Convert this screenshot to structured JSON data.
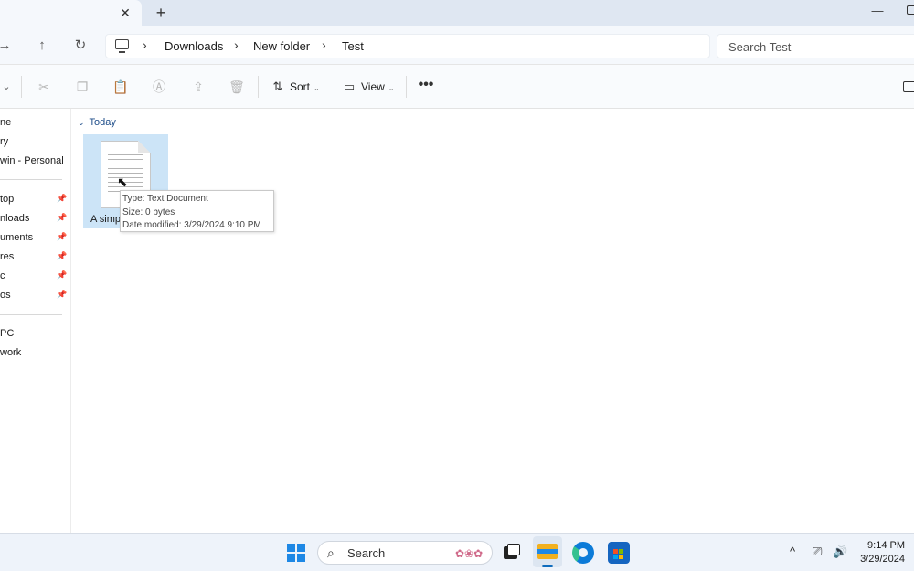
{
  "window": {
    "tab_close": "✕",
    "tab_new": "+",
    "minimize": "—"
  },
  "address": {
    "back": "→",
    "up": "↑",
    "refresh": "↻",
    "sep": "›",
    "breadcrumbs": [
      "Downloads",
      "New folder",
      "Test"
    ],
    "search_placeholder": "Search Test"
  },
  "toolbar": {
    "new_chevron": "⌄",
    "sort_label": "Sort",
    "view_label": "View",
    "more": "•••",
    "chevron": "⌄"
  },
  "sidebar": {
    "quick": [
      {
        "label": "ne"
      },
      {
        "label": "ry"
      },
      {
        "label": "win - Personal"
      }
    ],
    "pinned": [
      {
        "label": "top",
        "pin": "📌"
      },
      {
        "label": "nloads",
        "pin": "📌"
      },
      {
        "label": "uments",
        "pin": "📌"
      },
      {
        "label": "res",
        "pin": "📌"
      },
      {
        "label": "c",
        "pin": "📌"
      },
      {
        "label": "os",
        "pin": "📌"
      }
    ],
    "locations": [
      {
        "label": "PC"
      },
      {
        "label": "work"
      }
    ]
  },
  "content": {
    "group_header": "Today",
    "group_chevron": "⌄",
    "file": {
      "name": "A simp"
    },
    "tooltip": {
      "type": "Type: Text Document",
      "size": "Size: 0 bytes",
      "modified": "Date modified: 3/29/2024 9:10 PM"
    }
  },
  "taskbar": {
    "search_label": "Search",
    "search_deco": "✿❀✿",
    "tray_chevron": "^",
    "time": "9:14 PM",
    "date": "3/29/2024",
    "colors": {
      "windows_blue": "#1e88e5",
      "explorer_yellow": "#f2b01e",
      "edge_blue": "#0c7bd8",
      "store_blue": "#1565c0",
      "accent": "#0f6cbd"
    }
  }
}
